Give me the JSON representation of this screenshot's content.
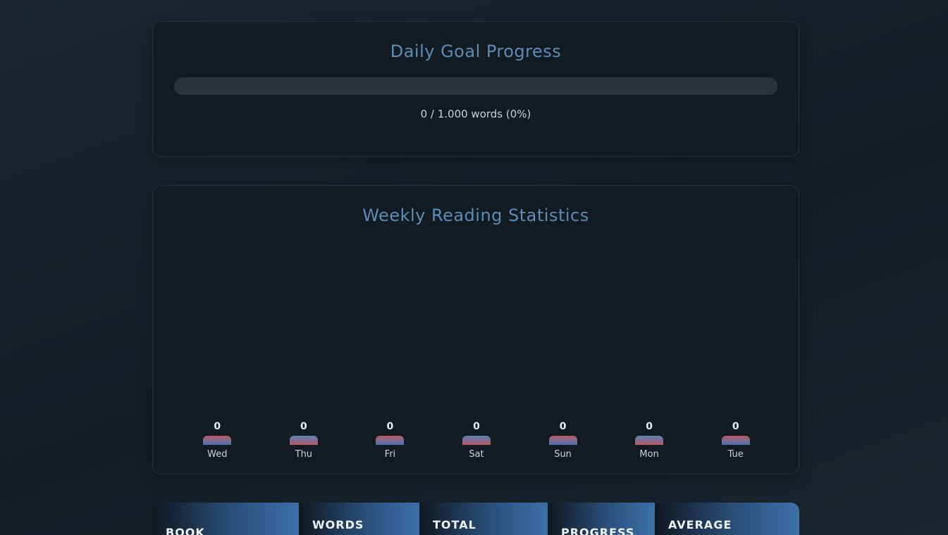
{
  "daily_goal": {
    "title": "Daily Goal Progress",
    "progress_fraction": 0,
    "progress_text": "0 / 1.000 words (0%)"
  },
  "weekly": {
    "title": "Weekly Reading Statistics",
    "chart_data": {
      "type": "bar",
      "categories": [
        "Wed",
        "Thu",
        "Fri",
        "Sat",
        "Sun",
        "Mon",
        "Tue"
      ],
      "values": [
        0,
        0,
        0,
        0,
        0,
        0,
        0
      ],
      "value_labels": [
        "0",
        "0",
        "0",
        "0",
        "0",
        "0",
        "0"
      ]
    }
  },
  "table": {
    "headers": [
      "BOOK",
      "WORDS",
      "TOTAL",
      "PROGRESS",
      "AVERAGE"
    ]
  },
  "colors": {
    "accent": "#5b8db8",
    "card_bg": "#121a22",
    "page_bg": "#18222c"
  }
}
